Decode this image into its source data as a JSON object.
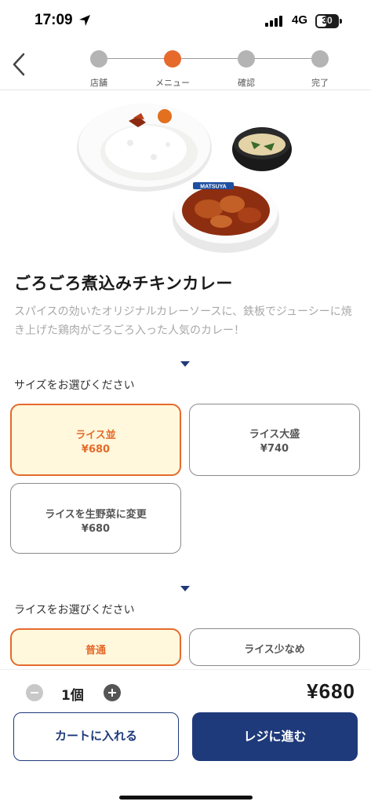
{
  "status": {
    "time": "17:09",
    "network": "4G",
    "battery": "30"
  },
  "steps": [
    {
      "label": "店舗",
      "active": false
    },
    {
      "label": "メニュー",
      "active": true
    },
    {
      "label": "確認",
      "active": false
    },
    {
      "label": "完了",
      "active": false
    }
  ],
  "product": {
    "image_icon": "curry-plate-image",
    "title": "ごろごろ煮込みチキンカレー",
    "description": "スパイスの効いたオリジナルカレーソースに、鉄板でジューシーに焼き上げた鶏肉がごろごろ入った人気のカレー！"
  },
  "size_section": {
    "label": "サイズをお選びください",
    "options": [
      {
        "name": "ライス並",
        "price": "¥680",
        "selected": true
      },
      {
        "name": "ライス大盛",
        "price": "¥740",
        "selected": false
      },
      {
        "name": "ライスを生野菜に変更",
        "price": "¥680",
        "selected": false
      }
    ]
  },
  "rice_section": {
    "label": "ライスをお選びください",
    "options": [
      {
        "name": "普通",
        "selected": true
      },
      {
        "name": "ライス少なめ",
        "selected": false
      }
    ]
  },
  "order": {
    "quantity": "1個",
    "total": "¥680",
    "cart_label": "カートに入れる",
    "checkout_label": "レジに進む"
  },
  "colors": {
    "accent": "#e56a2c",
    "primary": "#1e3a7a",
    "selected_bg": "#fff8dc"
  }
}
